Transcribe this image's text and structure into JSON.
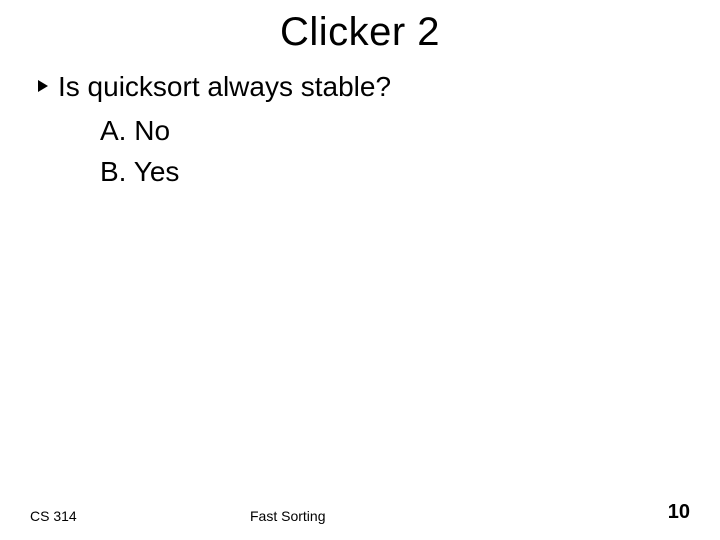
{
  "title": "Clicker 2",
  "question": "Is quicksort always stable?",
  "options": [
    "A. No",
    "B. Yes"
  ],
  "footer": {
    "left": "CS 314",
    "center": "Fast Sorting",
    "page_number": "10"
  }
}
